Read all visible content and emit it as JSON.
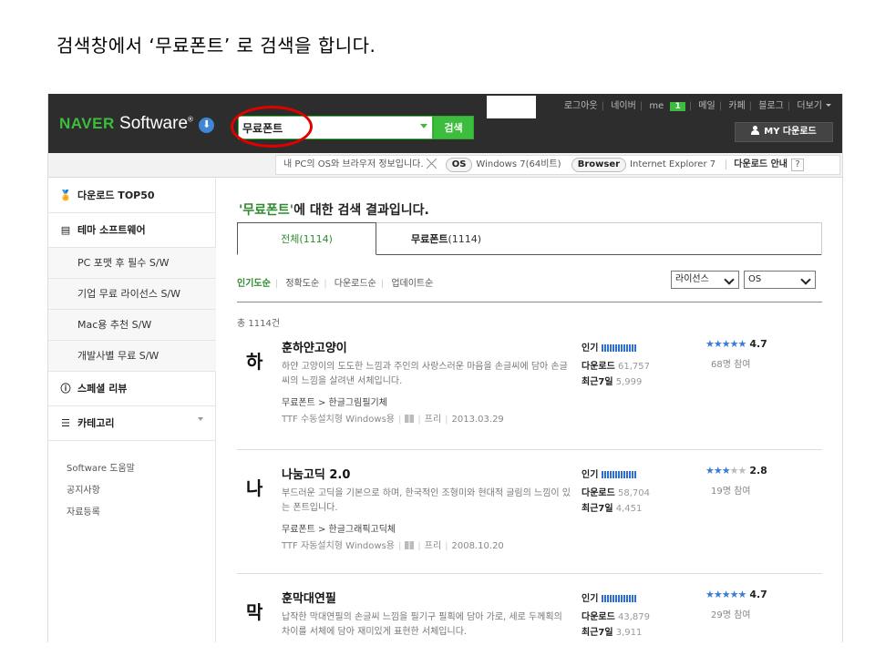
{
  "caption": "검색창에서 ‘무료폰트’ 로 검색을 합니다.",
  "header": {
    "logo_brand": "NAVER",
    "logo_product": "Software",
    "logo_reg": "®",
    "search_value": "무료폰트",
    "search_button": "검색",
    "gnb": {
      "logout": "로그아웃",
      "naver": "네이버",
      "me": "me",
      "me_count": "1",
      "mail": "메일",
      "cafe": "카페",
      "blog": "블로그",
      "more": "더보기"
    },
    "my_download": "MY 다운로드"
  },
  "infobar": {
    "notice": "내 PC의 OS와 브라우저 정보입니다.",
    "os_label": "OS",
    "os_value": "Windows 7(64비트)",
    "browser_label": "Browser",
    "browser_value": "Internet Explorer 7",
    "guide": "다운로드 안내",
    "help": "?"
  },
  "sidebar": {
    "top50": "다운로드 TOP50",
    "theme": "테마 소프트웨어",
    "theme_items": [
      "PC 포맷 후 필수 S/W",
      "기업 무료 라이선스 S/W",
      "Mac용 추천 S/W",
      "개발사별 무료 S/W"
    ],
    "special": "스페셜 리뷰",
    "category": "카테고리",
    "links": [
      "Software 도움말",
      "공지사항",
      "자료등록"
    ]
  },
  "main": {
    "title_keyword": "'무료폰트'",
    "title_rest": "에 대한 검색 결과입니다.",
    "tab_all": "전체",
    "tab_all_count": "(1114)",
    "tab_free": "무료폰트",
    "tab_free_count": "(1114)",
    "sort": [
      "인기도순",
      "정확도순",
      "다운로드순",
      "업데이트순"
    ],
    "filter_license": "라이선스",
    "filter_os": "OS",
    "total": "총 1114건",
    "labels": {
      "popularity": "인기",
      "downloads": "다운로드",
      "recent7": "최근7일"
    },
    "items": [
      {
        "glyph": "하",
        "name": "훈하얀고양이",
        "desc": "하얀 고양이의 도도한 느낌과 주인의 사랑스러운 마음을 손글씨에 담아 손글씨의 느낌을 살려낸 서체입니다.",
        "category": "무료폰트 > 한글그림필기체",
        "install": "TTF 수동설치형 Windows용",
        "license": "프리",
        "date": "2013.03.29",
        "downloads": "61,757",
        "recent7": "5,999",
        "stars": "★★★★★",
        "stars_off": "",
        "score": "4.7",
        "raters": "68명 참여"
      },
      {
        "glyph": "나",
        "name": "나눔고딕 2.0",
        "desc": "부드러운 고딕을 기본으로 하며, 한국적인 조형미와 현대적 글림의 느낌이 있는 폰트입니다.",
        "category": "무료폰트 > 한글그래픽고딕체",
        "install": "TTF 자동설치형 Windows용",
        "license": "프리",
        "date": "2008.10.20",
        "downloads": "58,704",
        "recent7": "4,451",
        "stars": "★★★",
        "stars_off": "★★",
        "score": "2.8",
        "raters": "19명 참여"
      },
      {
        "glyph": "막",
        "name": "훈막대연필",
        "desc": "납작한 막대연필의 손글씨 느낌을 필기구 필획에 담아 가로, 세로 두께획의 차이를 서체에 담아 재미있게 표현한 서체입니다.",
        "category": "",
        "install": "",
        "license": "",
        "date": "",
        "downloads": "43,879",
        "recent7": "3,911",
        "stars": "★★★★★",
        "stars_off": "",
        "score": "4.7",
        "raters": "29명 참여"
      }
    ]
  },
  "colors": {
    "brand_green": "#3dbd3d",
    "header_bg": "#2d2d2d",
    "highlight_red": "#e00000",
    "keyword_green": "#2e8a2e",
    "star_blue": "#3a7bd5"
  }
}
